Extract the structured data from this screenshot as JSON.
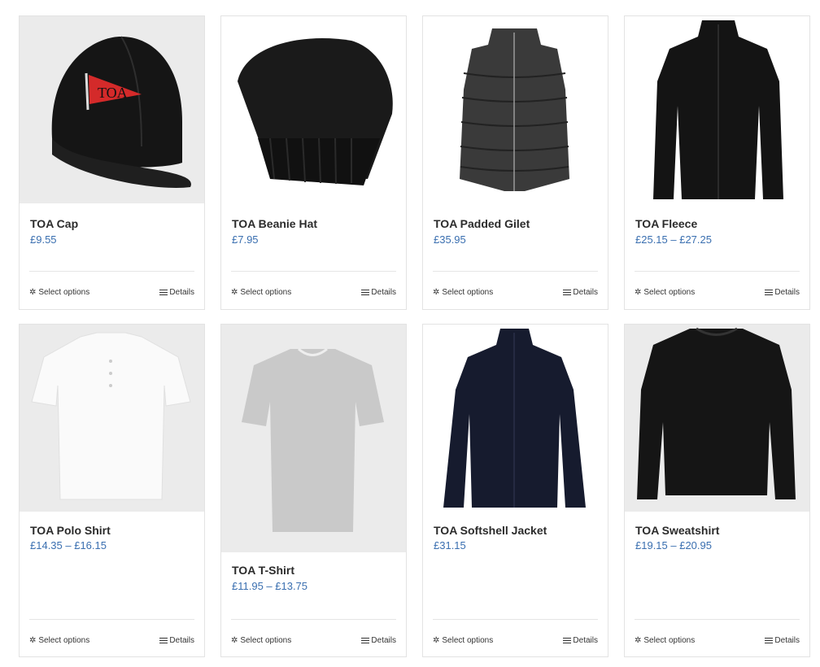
{
  "products": [
    {
      "name": "TOA Cap",
      "price": "£9.55",
      "select_label": "Select options",
      "details_label": "Details",
      "icon": "cap-image"
    },
    {
      "name": "TOA Beanie Hat",
      "price": "£7.95",
      "select_label": "Select options",
      "details_label": "Details",
      "icon": "beanie-image"
    },
    {
      "name": "TOA Padded Gilet",
      "price": "£35.95",
      "select_label": "Select options",
      "details_label": "Details",
      "icon": "gilet-image"
    },
    {
      "name": "TOA Fleece",
      "price": "£25.15 – £27.25",
      "select_label": "Select options",
      "details_label": "Details",
      "icon": "fleece-image"
    },
    {
      "name": "TOA Polo Shirt",
      "price": "£14.35 – £16.15",
      "select_label": "Select options",
      "details_label": "Details",
      "icon": "polo-shirt-image"
    },
    {
      "name": "TOA T-Shirt",
      "price": "£11.95 – £13.75",
      "select_label": "Select options",
      "details_label": "Details",
      "icon": "t-shirt-image"
    },
    {
      "name": "TOA Softshell Jacket",
      "price": "£31.15",
      "select_label": "Select options",
      "details_label": "Details",
      "icon": "softshell-jacket-image"
    },
    {
      "name": "TOA Sweatshirt",
      "price": "£19.15 – £20.95",
      "select_label": "Select options",
      "details_label": "Details",
      "icon": "sweatshirt-image"
    }
  ],
  "colors": {
    "price": "#3a6fb0",
    "title": "#2b2b2b",
    "image_bg": "#ebebeb"
  },
  "logo_text": "TOA"
}
